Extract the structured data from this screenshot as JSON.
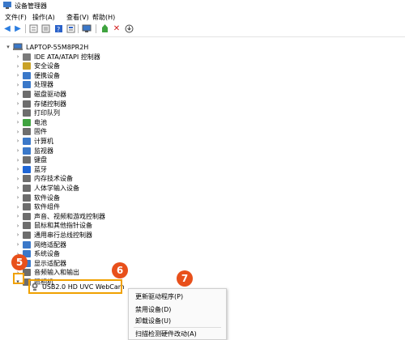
{
  "window": {
    "title": "设备管理器"
  },
  "menu": {
    "file": "文件(F)",
    "action": "操作(A)",
    "view": "查看(V)",
    "help": "帮助(H)"
  },
  "toolbar": {
    "icons": [
      "back-icon",
      "forward-icon",
      "properties-icon",
      "show-hide-icon",
      "help-icon",
      "details-icon",
      "monitor-icon",
      "update-driver-icon",
      "uninstall-icon",
      "scan-hardware-icon"
    ]
  },
  "tree": {
    "root": "LAPTOP-55M8PR2H",
    "items": [
      {
        "label": "IDE ATA/ATAPI 控制器",
        "color": "#7a7a7a"
      },
      {
        "label": "安全设备",
        "color": "#c9a227"
      },
      {
        "label": "便携设备",
        "color": "#3a78c9"
      },
      {
        "label": "处理器",
        "color": "#3a78c9"
      },
      {
        "label": "磁盘驱动器",
        "color": "#6d6d6d"
      },
      {
        "label": "存储控制器",
        "color": "#6d6d6d"
      },
      {
        "label": "打印队列",
        "color": "#6d6d6d"
      },
      {
        "label": "电池",
        "color": "#3fa33f"
      },
      {
        "label": "固件",
        "color": "#6d6d6d"
      },
      {
        "label": "计算机",
        "color": "#3a78c9"
      },
      {
        "label": "监视器",
        "color": "#3a78c9"
      },
      {
        "label": "键盘",
        "color": "#6d6d6d"
      },
      {
        "label": "蓝牙",
        "color": "#1f66d6"
      },
      {
        "label": "内存技术设备",
        "color": "#6d6d6d"
      },
      {
        "label": "人体学输入设备",
        "color": "#6d6d6d"
      },
      {
        "label": "软件设备",
        "color": "#6d6d6d"
      },
      {
        "label": "软件组件",
        "color": "#6d6d6d"
      },
      {
        "label": "声音、视频和游戏控制器",
        "color": "#6d6d6d"
      },
      {
        "label": "鼠标和其他指针设备",
        "color": "#6d6d6d"
      },
      {
        "label": "通用串行总线控制器",
        "color": "#6d6d6d"
      },
      {
        "label": "网络适配器",
        "color": "#3a78c9"
      },
      {
        "label": "系统设备",
        "color": "#3a78c9"
      },
      {
        "label": "显示适配器",
        "color": "#3a78c9"
      },
      {
        "label": "音频输入和输出",
        "color": "#6d6d6d"
      },
      {
        "label": "照相机",
        "color": "#6d6d6d"
      }
    ],
    "child": "USB2.0 HD UVC WebCam"
  },
  "context_menu": {
    "items": [
      "更新驱动程序(P)",
      "禁用设备(D)",
      "卸载设备(U)",
      "扫描检测硬件改动(A)"
    ]
  },
  "callouts": {
    "five": "5",
    "six": "6",
    "seven": "7"
  },
  "colors": {
    "callout": "#e8501b",
    "highlight": "#f0a100"
  }
}
